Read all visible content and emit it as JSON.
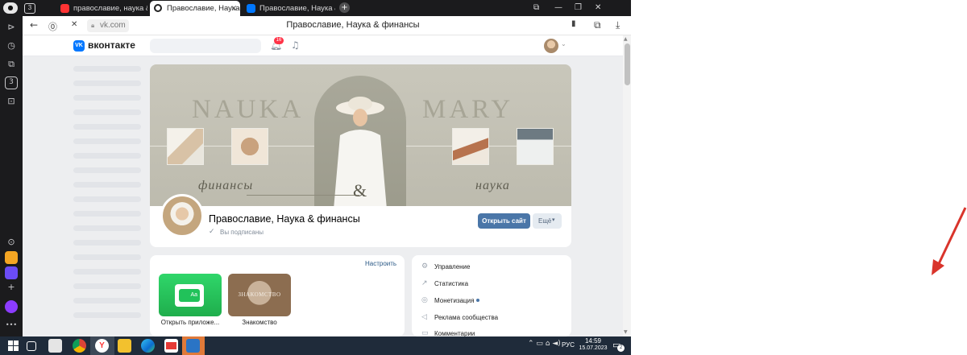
{
  "left_bar": {
    "tab_count": "3",
    "counter_box": "3",
    "more": "•••"
  },
  "tabs": [
    {
      "label": "православие, наука & финансы",
      "favicon_color": "#f33"
    },
    {
      "label": "Православие, Наука & финансы",
      "favicon_color": "#ffffff"
    },
    {
      "label": "Православие, Наука & финансы",
      "favicon_color": "#0077ff"
    }
  ],
  "tabbar": {
    "new_tab": "+",
    "close": "×",
    "minimize": "—",
    "restore": "❐",
    "window_close": "✕"
  },
  "addressbar": {
    "url": "vk.com",
    "page_title": "Православие, Наука & финансы",
    "back": "←",
    "stop": "✕"
  },
  "vk": {
    "logo_mark": "VK",
    "logo_text": "вконтакте",
    "notifications_count": "16",
    "cover": {
      "word_left": "NAUKA",
      "word_right": "MARY",
      "script_left": "финансы",
      "ampersand": "&",
      "script_right": "наука"
    },
    "group": {
      "name": "Православие, Наука & финансы",
      "subscribed_check": "✓",
      "subscribed": "Вы подписаны"
    },
    "open_site": "Открыть сайт",
    "more": "Ещё",
    "apps": {
      "configure": "Настроить",
      "items": [
        {
          "label": "Открыть приложе...",
          "tile_text": "Aa"
        },
        {
          "label": "Знакомство",
          "tile_text": "ЗНАКОМСТВО"
        }
      ]
    },
    "manage": [
      {
        "icon": "⚙",
        "label": "Управление"
      },
      {
        "icon": "↗",
        "label": "Статистика"
      },
      {
        "icon": "◎",
        "label": "Монетизация"
      },
      {
        "icon": "◁",
        "label": "Реклама сообщества"
      },
      {
        "icon": "▭",
        "label": "Комментарии"
      }
    ]
  },
  "taskbar": {
    "lang": "РУС",
    "time": "14:59",
    "date": "15.07.2023",
    "notif_count": "2"
  },
  "colors": {
    "vk_blue": "#0077ff",
    "button_blue": "#4a76a8",
    "arrow_red": "#d9342b",
    "taskbar": "#1f2b3a"
  }
}
